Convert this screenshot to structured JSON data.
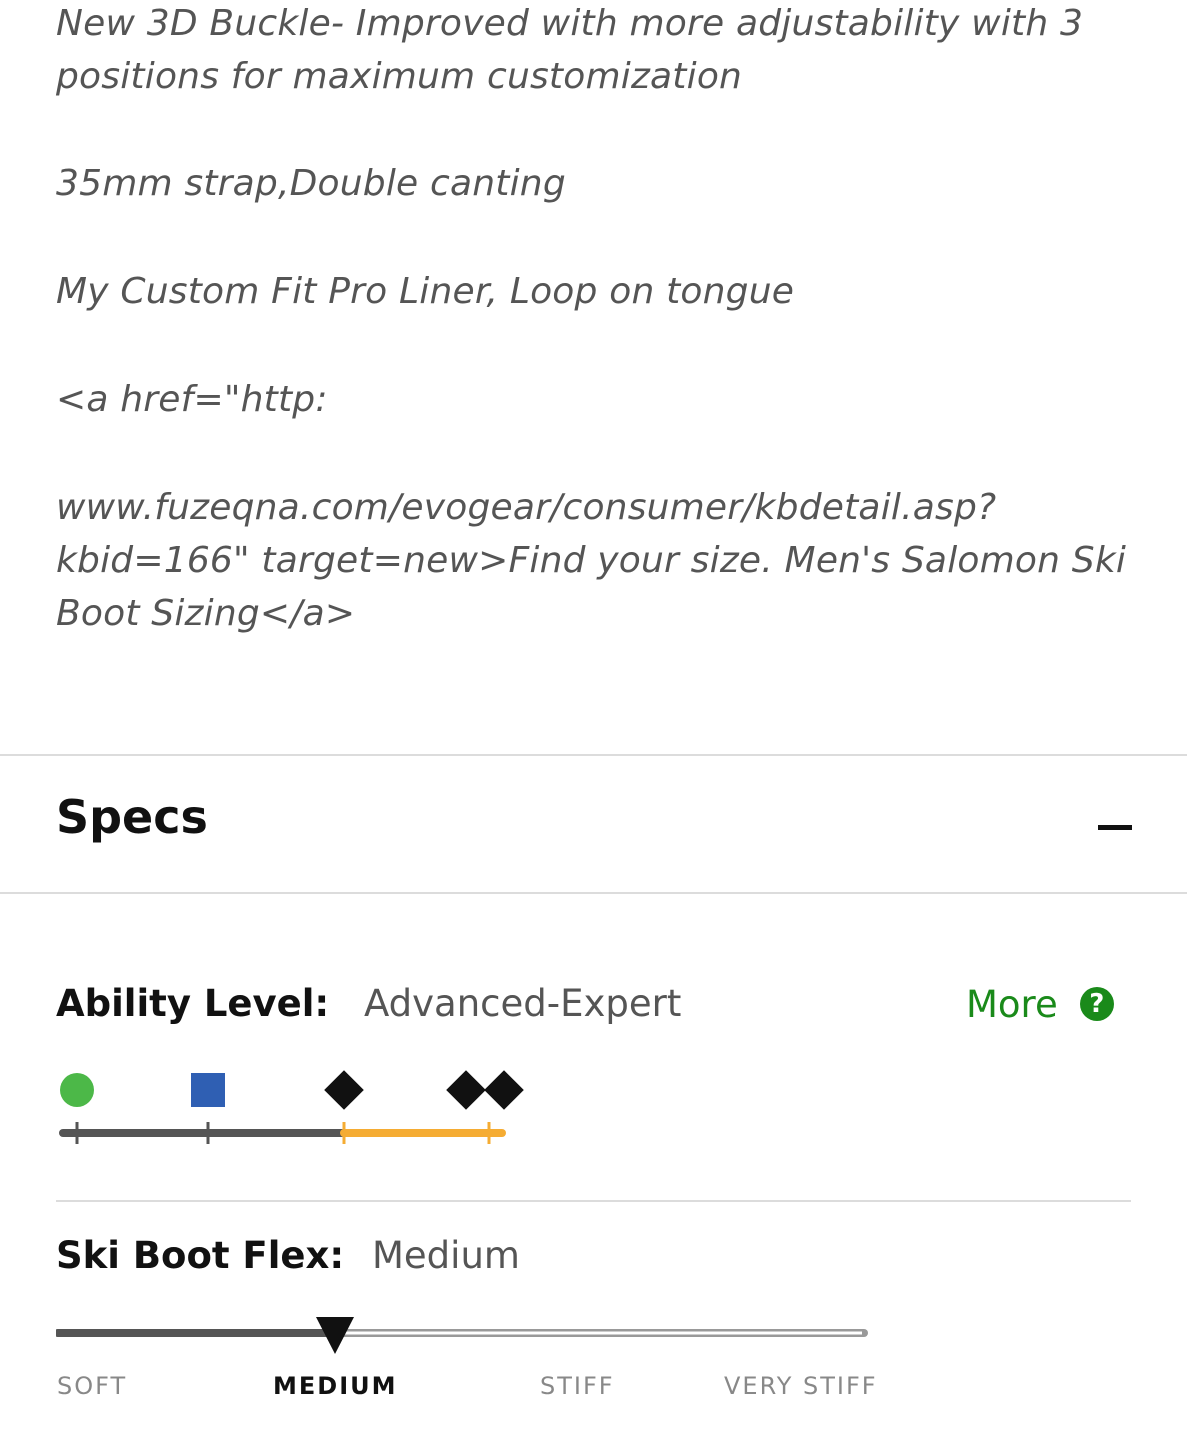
{
  "description": {
    "line1": "New 3D Buckle- Improved with more adjustability with 3 positions for maximum customization",
    "line2": "35mm strap,Double canting",
    "line3": "My Custom Fit Pro Liner, Loop on tongue",
    "line4": "<a href=\"http:",
    "line5": "www.fuzeqna.com/evogear/consumer/kbdetail.asp?kbid=166\" target=new>Find your size. Men's Salomon Ski Boot Sizing</a>"
  },
  "specs": {
    "title": "Specs",
    "collapse_icon": "minus-icon"
  },
  "ability": {
    "label": "Ability Level:",
    "value": "Advanced-Expert",
    "more_label": "More",
    "help_icon": "?",
    "levels": [
      {
        "icon": "green-circle-icon",
        "color": "#4cb848"
      },
      {
        "icon": "blue-square-icon",
        "color": "#2f5fb3"
      },
      {
        "icon": "black-diamond-icon",
        "color": "#111111"
      },
      {
        "icon": "double-black-diamond-icon",
        "color": "#111111"
      }
    ],
    "range": [
      2,
      3
    ],
    "accent_color": "#f5ac33"
  },
  "flex": {
    "label": "Ski Boot Flex:",
    "value": "Medium",
    "scale": [
      "SOFT",
      "MEDIUM",
      "STIFF",
      "VERY STIFF"
    ],
    "selected_index": 1
  }
}
